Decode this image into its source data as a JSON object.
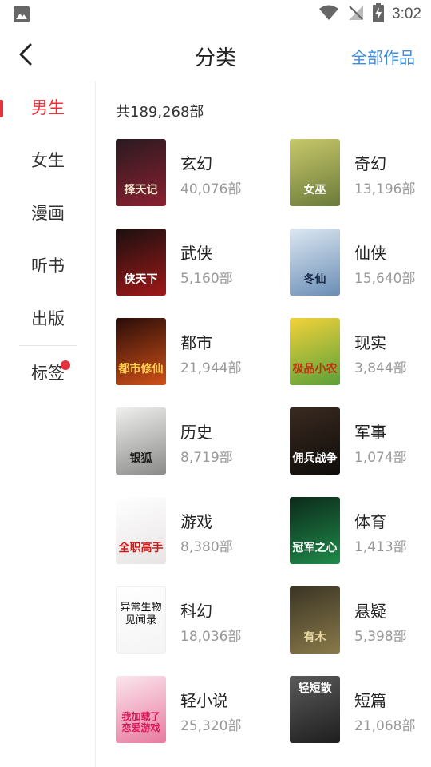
{
  "status_bar": {
    "time": "3:02"
  },
  "header": {
    "title": "分类",
    "all_works": "全部作品"
  },
  "sidebar": {
    "items": [
      {
        "label": "男生",
        "active": true
      },
      {
        "label": "女生"
      },
      {
        "label": "漫画"
      },
      {
        "label": "听书"
      },
      {
        "label": "出版"
      },
      {
        "label": "标签",
        "has_dot": true
      }
    ]
  },
  "main": {
    "total": "共189,268部",
    "categories": [
      {
        "name": "玄幻",
        "count": "40,076部",
        "cover_text": "择天记",
        "cover_colors": [
          "#2a1a20",
          "#8a2030"
        ],
        "cover_text_color": "#f5e6d0",
        "cover_label": "cover-xuanhuan"
      },
      {
        "name": "奇幻",
        "count": "13,196部",
        "cover_text": "女巫",
        "cover_colors": [
          "#c8c86a",
          "#6a7a3a"
        ],
        "cover_text_color": "#ffffff",
        "cover_label": "cover-qihuan"
      },
      {
        "name": "武侠",
        "count": "5,160部",
        "cover_text": "侠天下",
        "cover_colors": [
          "#1a1010",
          "#a01818"
        ],
        "cover_text_color": "#ffffff",
        "cover_label": "cover-wuxia"
      },
      {
        "name": "仙侠",
        "count": "15,640部",
        "cover_text": "冬仙",
        "cover_colors": [
          "#dde8f2",
          "#6a8db5"
        ],
        "cover_text_color": "#1a2a4a",
        "cover_label": "cover-xianxia"
      },
      {
        "name": "都市",
        "count": "21,944部",
        "cover_text": "都市修仙",
        "cover_colors": [
          "#2a0c08",
          "#d05018"
        ],
        "cover_text_color": "#ffd24a",
        "cover_label": "cover-dushi"
      },
      {
        "name": "现实",
        "count": "3,844部",
        "cover_text": "极品小农",
        "cover_colors": [
          "#f2d23a",
          "#5aa03a"
        ],
        "cover_text_color": "#c03010",
        "cover_label": "cover-xianshi"
      },
      {
        "name": "历史",
        "count": "8,719部",
        "cover_text": "银狐",
        "cover_colors": [
          "#f0f0ee",
          "#8a8a88"
        ],
        "cover_text_color": "#1a1a1a",
        "cover_label": "cover-lishi"
      },
      {
        "name": "军事",
        "count": "1,074部",
        "cover_text": "佣兵战争",
        "cover_colors": [
          "#3a2a20",
          "#0e0c0a"
        ],
        "cover_text_color": "#ffffff",
        "cover_label": "cover-junshi"
      },
      {
        "name": "游戏",
        "count": "8,380部",
        "cover_text": "全职高手",
        "cover_colors": [
          "#ffffff",
          "#e8e4e4"
        ],
        "cover_text_color": "#d01818",
        "cover_label": "cover-youxi"
      },
      {
        "name": "体育",
        "count": "1,413部",
        "cover_text": "冠军之心",
        "cover_colors": [
          "#0c2a1a",
          "#1f8a4a"
        ],
        "cover_text_color": "#ffffff",
        "cover_label": "cover-tiyu"
      },
      {
        "name": "科幻",
        "count": "18,036部",
        "cover_text": "异常生物见闻录",
        "cover_colors": [
          "#ffffff",
          "#f4f4f4"
        ],
        "cover_text_color": "#111111",
        "cover_label": "cover-kehuan"
      },
      {
        "name": "悬疑",
        "count": "5,398部",
        "cover_text": "有木",
        "cover_colors": [
          "#3a3424",
          "#8a7a4a"
        ],
        "cover_text_color": "#e8d8a0",
        "cover_label": "cover-xuanyi"
      },
      {
        "name": "轻小说",
        "count": "25,320部",
        "cover_text": "我加载了恋爱游戏",
        "cover_colors": [
          "#fbe6ee",
          "#e87aa0"
        ],
        "cover_text_color": "#d81858",
        "cover_label": "cover-qingxiaoshuo"
      },
      {
        "name": "短篇",
        "count": "21,068部",
        "cover_text": "轻短散",
        "cover_colors": [
          "#5a5a5a",
          "#1e1e1e"
        ],
        "cover_text_color": "#ffffff",
        "cover_label": "cover-duanpian"
      }
    ]
  },
  "colors": {
    "accent": "#e5323c",
    "link": "#3f8ee0",
    "muted": "#999999"
  },
  "icons": {
    "status_left": "image-icon",
    "wifi": "wifi-icon",
    "signal": "no-signal-icon",
    "battery": "battery-charging-icon",
    "back": "back-arrow-icon"
  }
}
